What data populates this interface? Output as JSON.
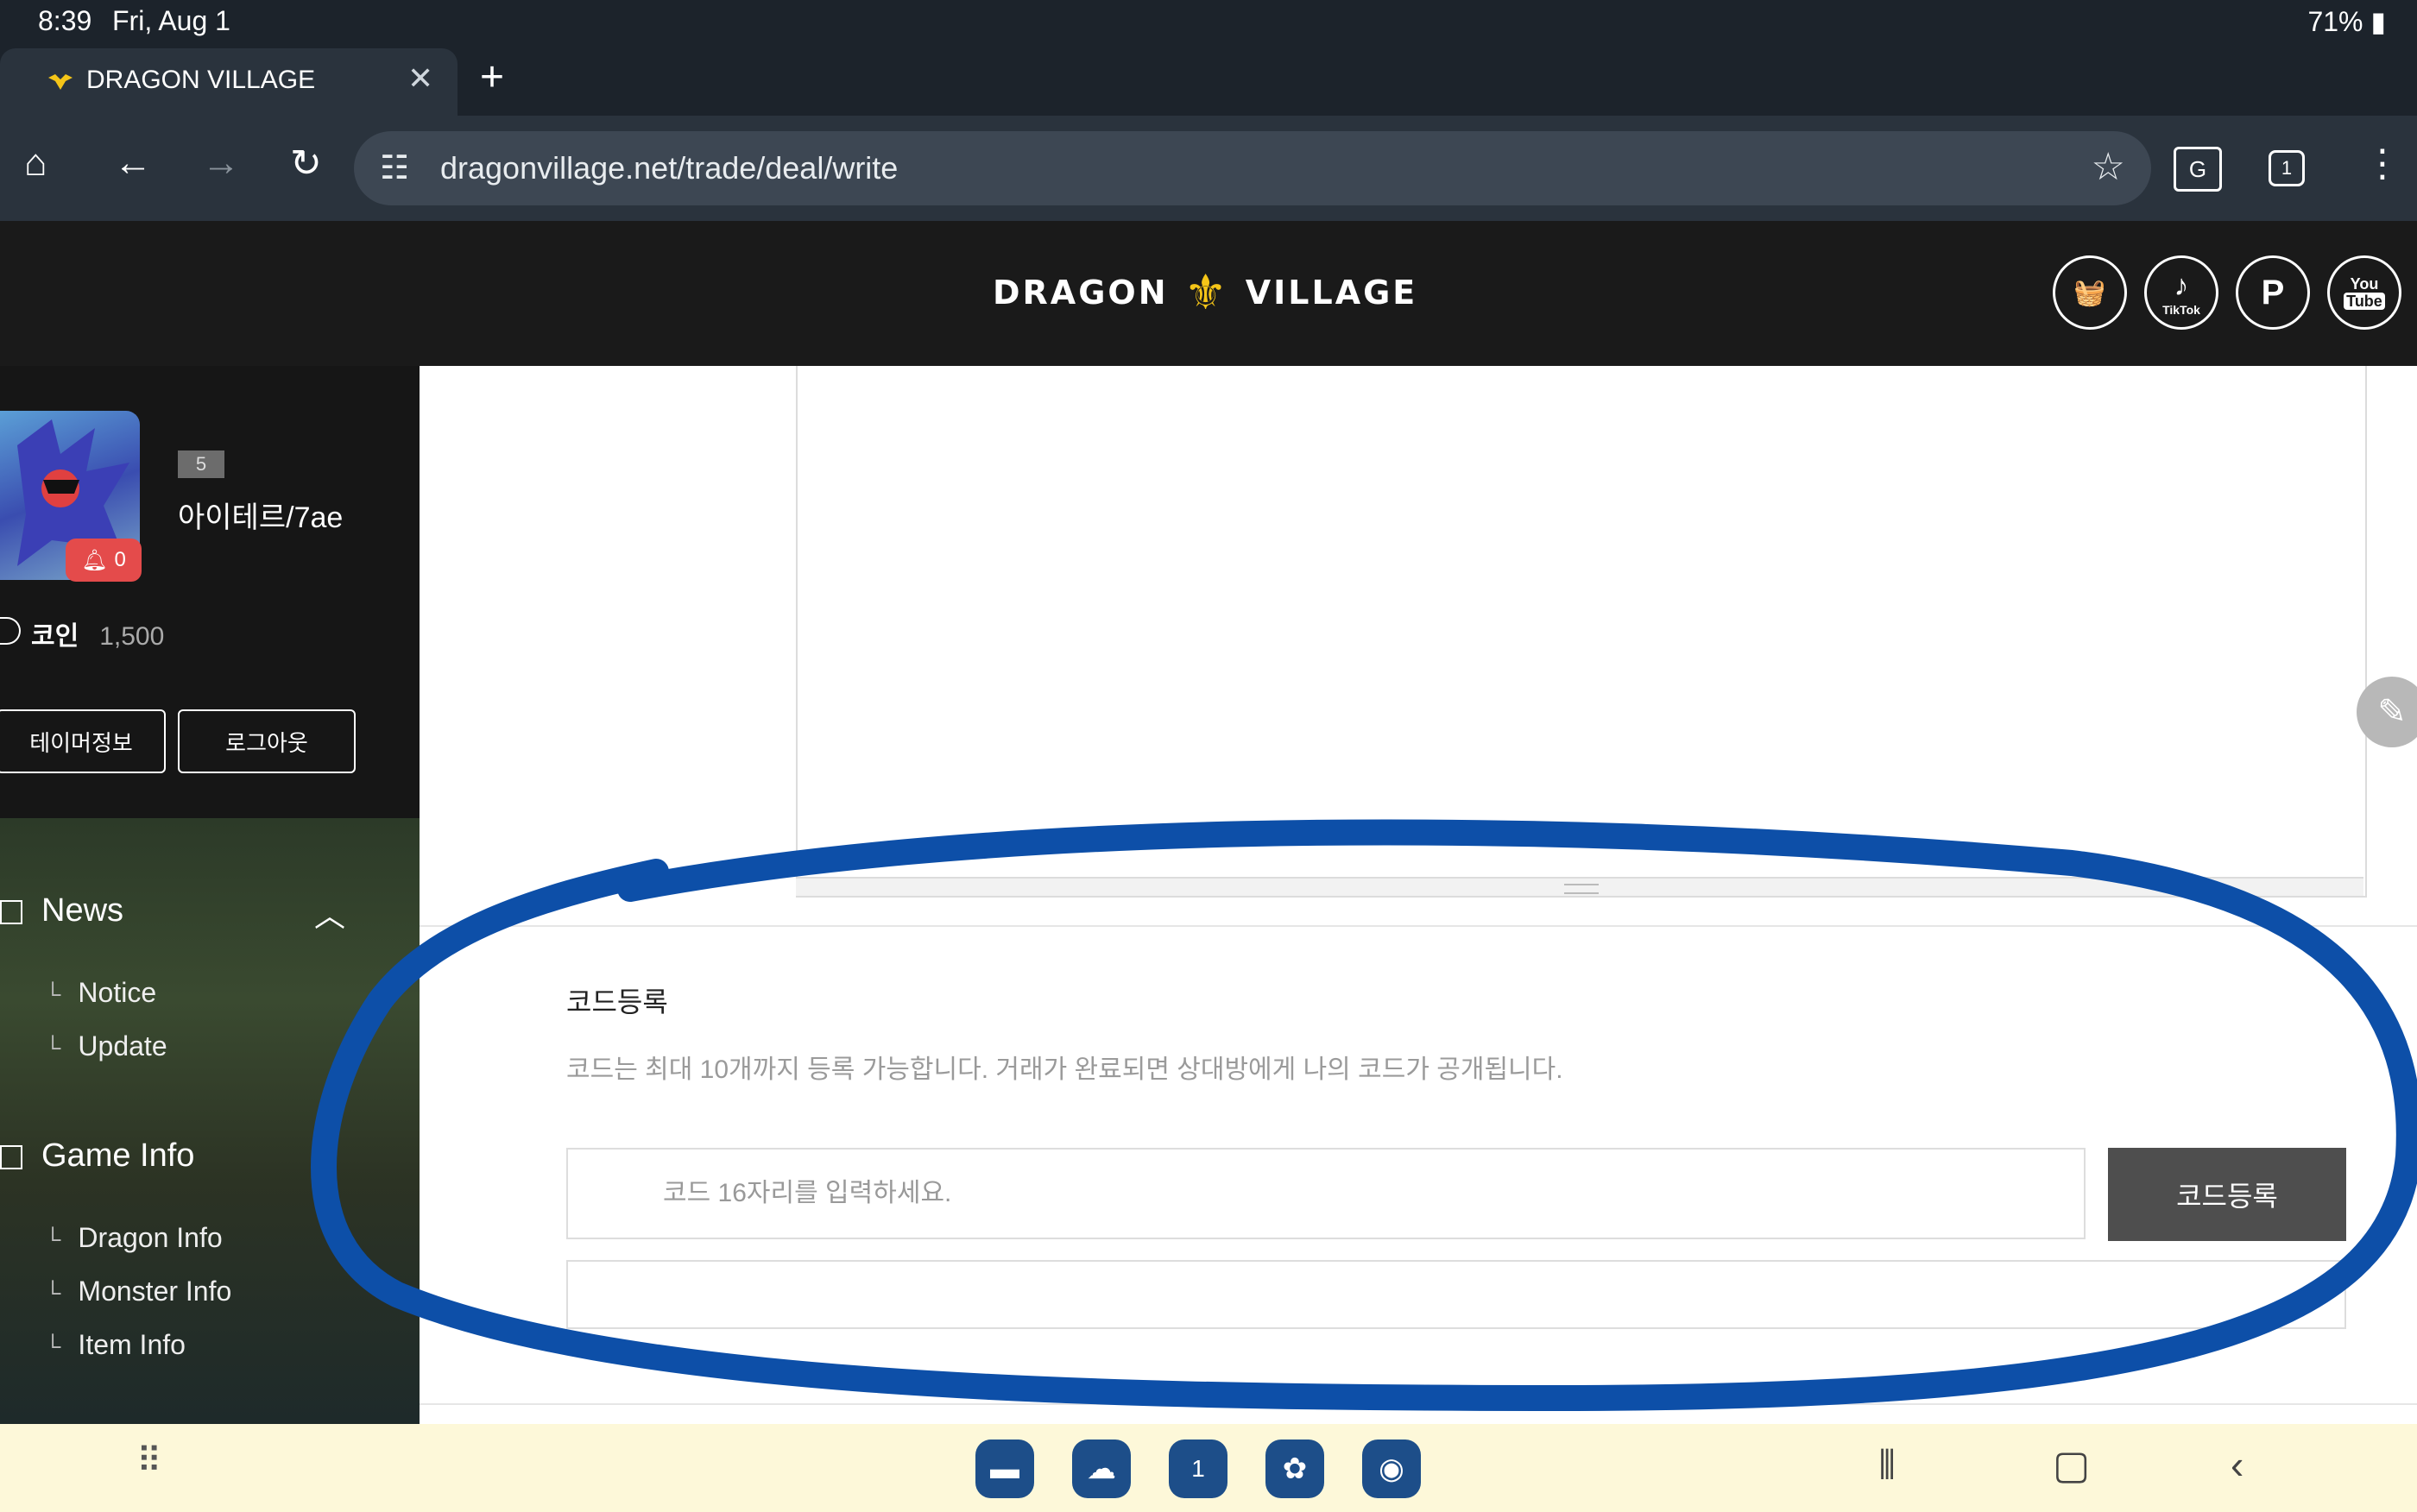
{
  "status_bar": {
    "time": "8:39",
    "date": "Fri, Aug 1",
    "battery": "71%"
  },
  "browser": {
    "tab_title": "DRAGON VILLAGE",
    "url": "dragonvillage.net/trade/deal/write",
    "tab_count": "1"
  },
  "site": {
    "logo_left": "DRAGON",
    "logo_right": "VILLAGE",
    "social": [
      {
        "name": "basket",
        "label": "🧺"
      },
      {
        "name": "tiktok",
        "label": "♪"
      },
      {
        "name": "p",
        "label": "P"
      },
      {
        "name": "youtube",
        "label": "You Tube"
      }
    ]
  },
  "sidebar": {
    "level": "5",
    "username": "아이테르/7ae",
    "notifications": "0",
    "coin_label": "코인",
    "coin_value": "1,500",
    "btn_profile": "테이머정보",
    "btn_logout": "로그아웃",
    "menu": {
      "news": "News",
      "news_items": [
        "Notice",
        "Update"
      ],
      "gameinfo": "Game Info",
      "gameinfo_items": [
        "Dragon Info",
        "Monster Info",
        "Item Info"
      ]
    }
  },
  "main": {
    "code_title": "코드등록",
    "code_desc": "코드는 최대 10개까지 등록 가능합니다. 거래가 완료되면 상대방에게 나의 코드가 공개됩니다.",
    "code_placeholder": "코드 16자리를 입력하세요.",
    "code_button": "코드등록"
  },
  "colors": {
    "annotation_ring": "#0d4fa8",
    "button_dark": "#4e4e4e",
    "navbar_bg": "#fdf8d9"
  }
}
